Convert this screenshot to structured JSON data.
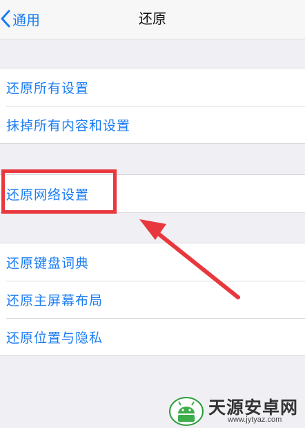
{
  "navbar": {
    "back_label": "通用",
    "title": "还原"
  },
  "groups": [
    {
      "items": [
        {
          "label": "还原所有设置"
        },
        {
          "label": "抹掉所有内容和设置"
        }
      ]
    },
    {
      "items": [
        {
          "label": "还原网络设置"
        }
      ]
    },
    {
      "items": [
        {
          "label": "还原键盘词典"
        },
        {
          "label": "还原主屏幕布局"
        },
        {
          "label": "还原位置与隐私"
        }
      ]
    }
  ],
  "annotation": {
    "highlight_color": "#e8383d",
    "highlighted_item": "还原网络设置"
  },
  "watermark": {
    "name": "天源安卓网",
    "url": "www.jytyaz.com"
  },
  "colors": {
    "accent": "#1a7cf3",
    "background": "#efeff4"
  }
}
